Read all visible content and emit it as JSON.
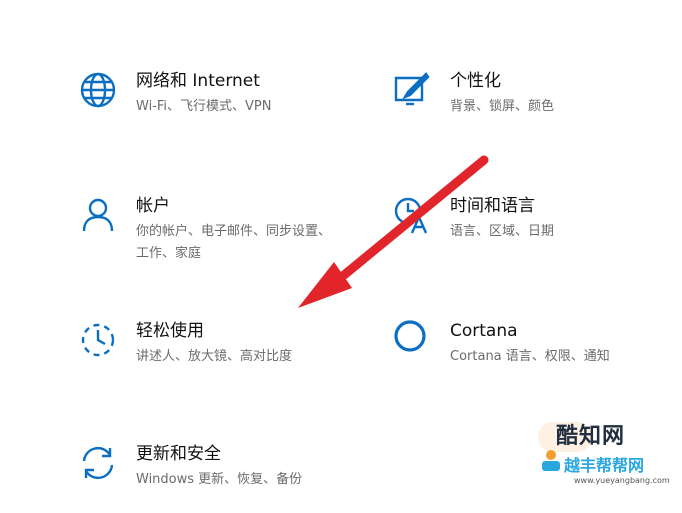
{
  "settings": {
    "tiles": [
      {
        "title": "网络和 Internet",
        "desc": "Wi-Fi、飞行模式、VPN",
        "icon": "globe-icon"
      },
      {
        "title": "个性化",
        "desc": "背景、锁屏、颜色",
        "icon": "personalization-icon"
      },
      {
        "title": "帐户",
        "desc": "你的帐户、电子邮件、同步设置、工作、家庭",
        "icon": "person-icon"
      },
      {
        "title": "时间和语言",
        "desc": "语言、区域、日期",
        "icon": "time-language-icon"
      },
      {
        "title": "轻松使用",
        "desc": "讲述人、放大镜、高对比度",
        "icon": "ease-of-access-icon"
      },
      {
        "title": "Cortana",
        "desc": "Cortana 语言、权限、通知",
        "icon": "cortana-icon"
      },
      {
        "title": "更新和安全",
        "desc": "Windows 更新、恢复、备份",
        "icon": "sync-icon"
      }
    ]
  },
  "colors": {
    "icon": "#0a6ec2",
    "arrow": "#e2242b"
  },
  "watermark": {
    "title": "酷知网",
    "subtitle": "越丰帮帮网",
    "url": "www.yueyangbang.com"
  }
}
